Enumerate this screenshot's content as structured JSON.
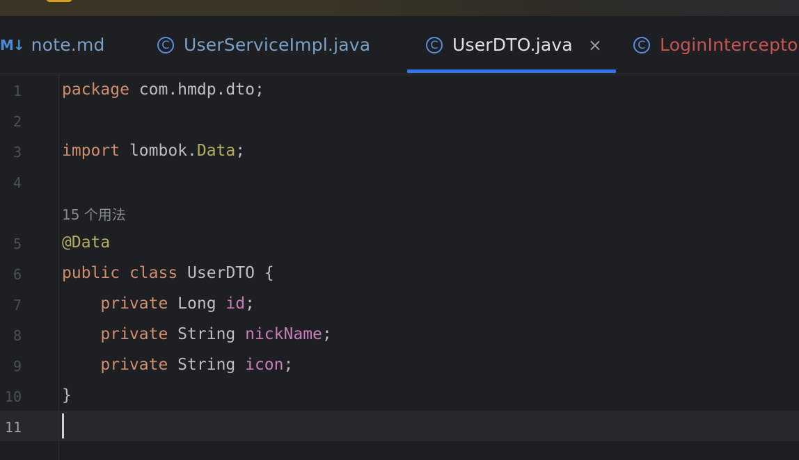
{
  "tabs": [
    {
      "icon": "markdown-icon",
      "icon_text": "M↓",
      "label": "note.md",
      "color": "#7aa0c8"
    },
    {
      "icon": "class-icon",
      "icon_text": "C",
      "label": "UserServiceImpl.java",
      "color": "#7aa0c8"
    },
    {
      "icon": "class-icon",
      "icon_text": "C",
      "label": "UserDTO.java",
      "color": "#dfe1e5",
      "active": true,
      "close": "×"
    },
    {
      "icon": "class-icon",
      "icon_text": "C",
      "label": "LoginInterceptor",
      "color": "#c75450"
    }
  ],
  "editor": {
    "line_numbers": [
      "1",
      "2",
      "3",
      "4",
      "5",
      "6",
      "7",
      "8",
      "9",
      "10",
      "11"
    ],
    "active_line": "11",
    "usage_hint": "15 个用法",
    "code": {
      "l1_kw": "package",
      "l1_rest": " com.hmdp.dto;",
      "l3_kw": "import",
      "l3_pkg": " lombok.",
      "l3_ann": "Data",
      "l3_end": ";",
      "l5_ann": "@Data",
      "l6_kw1": "public",
      "l6_kw2": "class",
      "l6_rest": " UserDTO {",
      "l7_kw": "private",
      "l7_type": " Long ",
      "l7_fld": "id",
      "l7_end": ";",
      "l8_kw": "private",
      "l8_type": " String ",
      "l8_fld": "nickName",
      "l8_end": ";",
      "l9_kw": "private",
      "l9_type": " String ",
      "l9_fld": "icon",
      "l9_end": ";",
      "l10": "}"
    }
  },
  "colors": {
    "keyword": "#cf8e6d",
    "annotation": "#b3ae60",
    "field": "#c77dbb",
    "text": "#bcbec4",
    "accent": "#3574f0"
  }
}
